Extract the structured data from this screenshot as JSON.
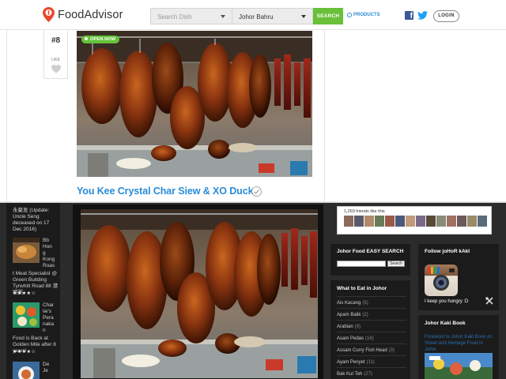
{
  "header": {
    "logo_text": "FoodAdvisor",
    "search_placeholder": "Search Dish",
    "location": "Johor Bahru",
    "search_button": "SEARCH",
    "products_link": "PRODUCTS",
    "login_button": "LOGIN",
    "colors": {
      "brand_red": "#e8472c",
      "search_green": "#69c039",
      "link_blue": "#2a8bd6"
    }
  },
  "listing": {
    "rank": "#8",
    "like_label": "LIKE",
    "status_badge": "OPEN NOW",
    "title": "You Kee Crystal Char Siew & XO Duck"
  },
  "blog_sidebar_left": {
    "news_text": "永豪发 (Update: Uncle Seng deceased on 17 Dec 2016)",
    "item1_side": "Bb Hon g Kong Roas t Meat Specialist @ Green Building Tyrwhitt Road 88 港明粥",
    "item1_side_lines": [
      "Bb",
      "Hon",
      "g",
      "Kong",
      "Roas"
    ],
    "item1_full": "t Meat Specialist @ Green Building Tyrwhitt Road 88 港明粥",
    "item1_stars": "★★★★☆",
    "item2_side_lines": [
      "Char",
      "lie's",
      "Pera",
      "naka",
      "n"
    ],
    "item2_full": "Food is Back at Golden Mile after 8 years!",
    "item2_stars": "★★★★☆",
    "item3_side_lines": [
      "De",
      "Je"
    ]
  },
  "blog_right": {
    "friends_text": "1,269 friends like this",
    "easy_search_title": "Johor Food EASY SEARCH",
    "easy_search_button": "Search",
    "eat_title": "What to Eat in Johor",
    "categories": [
      {
        "name": "Ais Kacang",
        "count": "(5)"
      },
      {
        "name": "Apam Balik",
        "count": "(2)"
      },
      {
        "name": "Arabian",
        "count": "(9)"
      },
      {
        "name": "Asam Pedas",
        "count": "(16)"
      },
      {
        "name": "Assam Curry Fish Head",
        "count": "(3)"
      },
      {
        "name": "Ayam Penyet",
        "count": "(11)"
      },
      {
        "name": "Bak Kut Teh",
        "count": "(27)"
      }
    ],
    "follow_title": "Follow joHoR kAkI",
    "hungry_text": "I keep you hungry :D",
    "book_title": "Johor Kaki Book",
    "book_desc": "Foreword to Johor Kaki Book on Street and Heritage Food in Johor"
  }
}
